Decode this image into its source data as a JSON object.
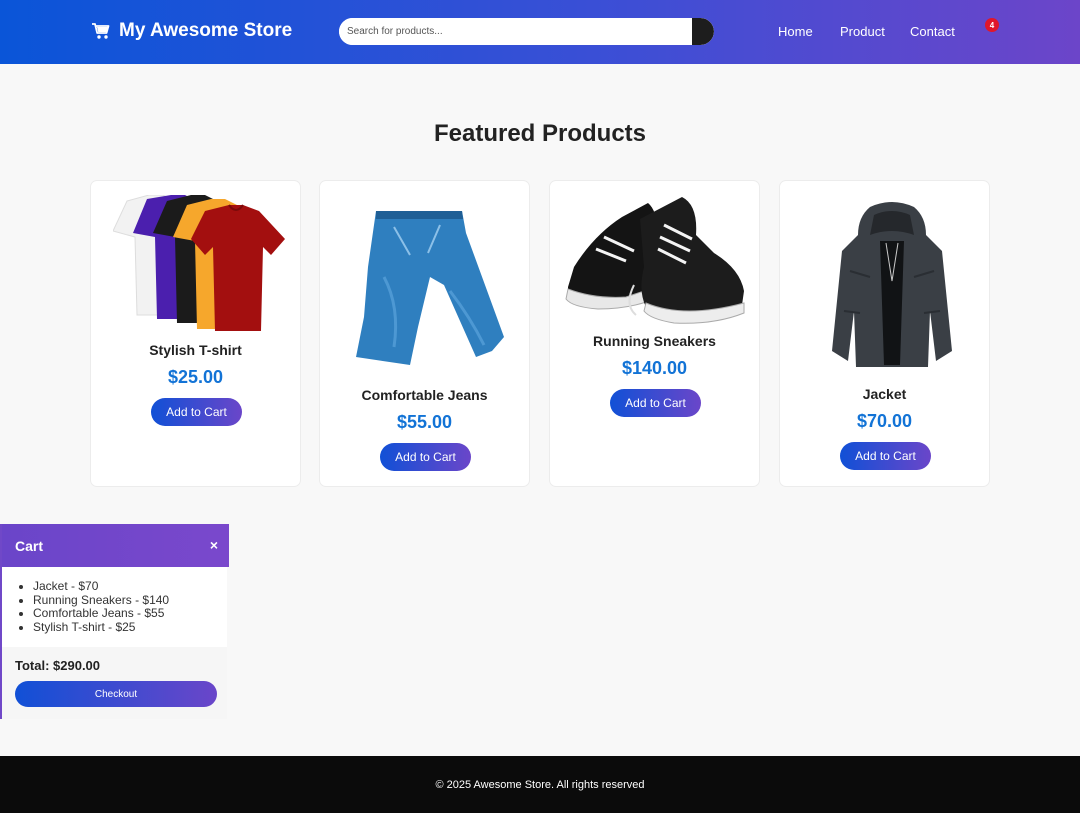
{
  "header": {
    "logo_text": "My Awesome Store",
    "search_placeholder": "Search for products...",
    "nav": [
      "Home",
      "Product",
      "Contact"
    ],
    "cart_count": "4"
  },
  "featured": {
    "title": "Featured Products",
    "products": [
      {
        "name": "Stylish T-shirt",
        "price": "$25.00",
        "button": "Add to Cart"
      },
      {
        "name": "Comfortable Jeans",
        "price": "$55.00",
        "button": "Add to Cart"
      },
      {
        "name": "Running Sneakers",
        "price": "$140.00",
        "button": "Add to Cart"
      },
      {
        "name": "Jacket",
        "price": "$70.00",
        "button": "Add to Cart"
      }
    ]
  },
  "cart": {
    "title": "Cart",
    "close": "×",
    "items": [
      "Jacket - $70",
      "Running Sneakers - $140",
      "Comfortable Jeans - $55",
      "Stylish T-shirt - $25"
    ],
    "total": "Total: $290.00",
    "checkout": "Checkout"
  },
  "footer": {
    "text": "© 2025 Awesome Store. All rights reserved"
  },
  "colors": {
    "header_start": "#0a55d8",
    "header_end": "#6c45c9",
    "price": "#1273d6",
    "badge": "#e0162b",
    "footer": "#0b0b0b"
  }
}
